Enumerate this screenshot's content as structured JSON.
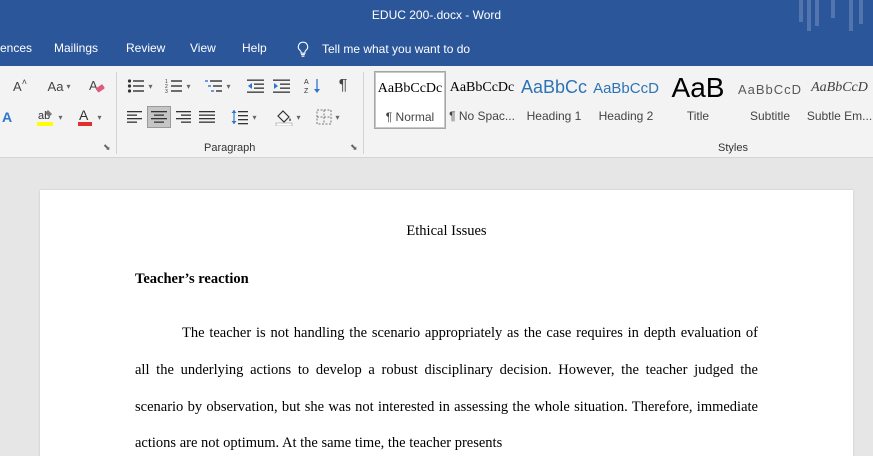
{
  "window": {
    "title": "EDUC 200-.docx  -  Word"
  },
  "tabs": [
    {
      "label": "ences"
    },
    {
      "label": "Mailings"
    },
    {
      "label": "Review"
    },
    {
      "label": "View"
    },
    {
      "label": "Help"
    }
  ],
  "tell_me": {
    "label": "Tell me what you want to do"
  },
  "ribbon": {
    "font_group": {
      "grow_label": "A",
      "change_case_label": "Aa"
    },
    "paragraph_group": {
      "label": "Paragraph"
    },
    "styles_group": {
      "label": "Styles",
      "items": [
        {
          "sample": "AaBbCcDc",
          "name": "¶ Normal",
          "color": "#000000",
          "selected": true
        },
        {
          "sample": "AaBbCcDc",
          "name": "¶ No Spac...",
          "color": "#000000"
        },
        {
          "sample": "AaBbCc",
          "name": "Heading 1",
          "color": "#2e74b5"
        },
        {
          "sample": "AaBbCcD",
          "name": "Heading 2",
          "color": "#2e74b5"
        },
        {
          "sample": "AaB",
          "name": "Title",
          "color": "#000000"
        },
        {
          "sample": "AaBbCcD",
          "name": "Subtitle",
          "color": "#595959"
        },
        {
          "sample": "AaBbCcD",
          "name": "Subtle Em...",
          "color": "#404040"
        }
      ]
    }
  },
  "document": {
    "title": "Ethical Issues",
    "heading": "Teacher’s reaction",
    "paragraph": "The teacher is not handling the scenario appropriately as the case requires in depth evaluation of all the underlying actions to develop a robust disciplinary decision. However, the teacher judged the scenario by observation, but she was not interested in assessing the whole situation. Therefore, immediate actions are not optimum. At the same time, the teacher presents"
  },
  "colors": {
    "brand": "#2b579a",
    "ribbon_bg": "#f3f3f3",
    "canvas_bg": "#e6e6e6"
  }
}
